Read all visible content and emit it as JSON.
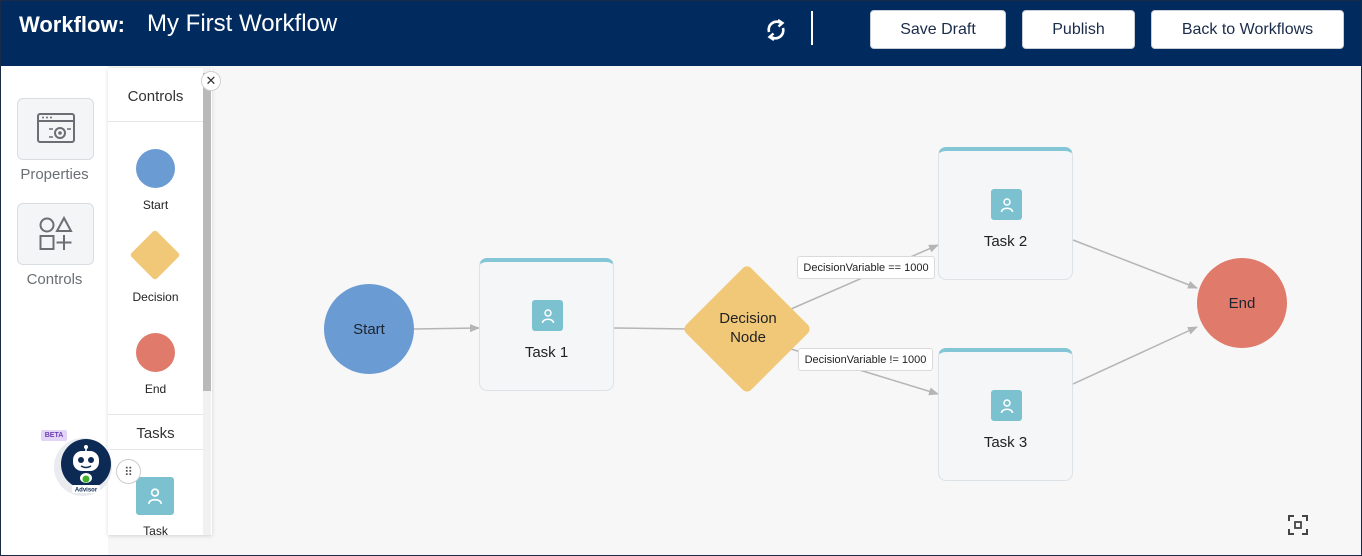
{
  "header": {
    "label": "Workflow:",
    "title": "My First Workflow",
    "buttons": {
      "save_draft": "Save Draft",
      "publish": "Publish",
      "back": "Back to Workflows"
    }
  },
  "rail": {
    "properties": "Properties",
    "controls": "Controls"
  },
  "panel": {
    "controls_heading": "Controls",
    "tasks_heading": "Tasks",
    "items": {
      "start": "Start",
      "decision": "Decision",
      "end": "End",
      "task": "Task"
    }
  },
  "advisor": {
    "badge": "BETA",
    "label": "Advisor"
  },
  "flow": {
    "nodes": {
      "start": "Start",
      "task1": "Task 1",
      "decision_line1": "Decision",
      "decision_line2": "Node",
      "task2": "Task 2",
      "task3": "Task 3",
      "end": "End"
    },
    "edges": {
      "eq": "DecisionVariable == 1000",
      "neq": "DecisionVariable != 1000"
    }
  },
  "colors": {
    "header": "#012b5e",
    "start": "#6a9bd2",
    "decision": "#f1c878",
    "end": "#e07a6b",
    "task_accent": "#84c6d6"
  },
  "icons": [
    "refresh-icon",
    "properties-icon",
    "shapes-icon",
    "close-icon",
    "user-icon",
    "drag-handle-icon",
    "fit-screen-icon",
    "advisor-robot-icon"
  ]
}
